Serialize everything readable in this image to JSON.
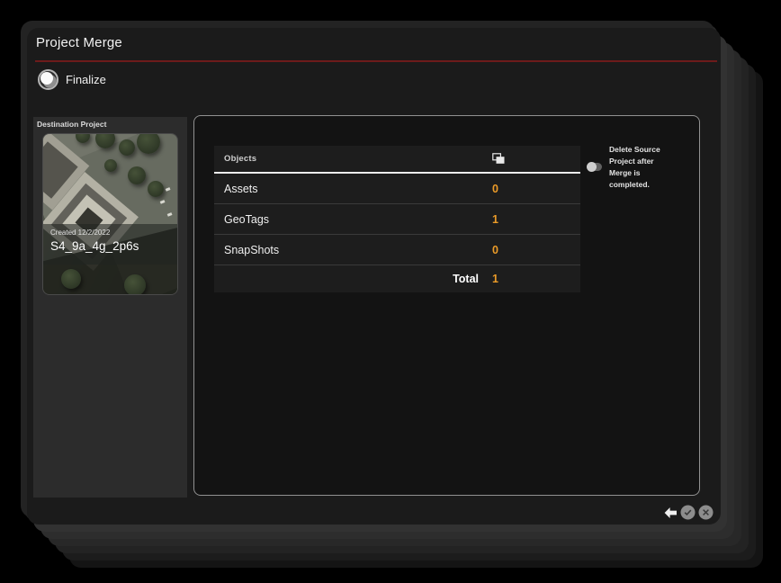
{
  "window": {
    "title": "Project Merge"
  },
  "step": {
    "label": "Finalize"
  },
  "sidebar": {
    "title": "Destination Project",
    "project": {
      "created": "Created 12/2/2022",
      "name": "S4_9a_4g_2p6s"
    }
  },
  "table": {
    "header": "Objects",
    "rows": [
      {
        "label": "Assets",
        "value": "0"
      },
      {
        "label": "GeoTags",
        "value": "1"
      },
      {
        "label": "SnapShots",
        "value": "0"
      }
    ],
    "total_label": "Total",
    "total_value": "1"
  },
  "toggle": {
    "label": "Delete Source Project after Merge is completed.",
    "state": "off"
  },
  "icons": {
    "step": "merge-spheres-icon",
    "table_header": "copy-icon",
    "toggle": "switch-off",
    "footer": [
      "back-arrow-icon",
      "check-circle-icon",
      "close-circle-icon"
    ]
  },
  "colors": {
    "value_accent": "#EB9B28",
    "title_divider": "#6D1B1B",
    "window_bg": "#1B1B1B",
    "sidebar_bg": "#2C2C2C",
    "panel_bg": "#131313",
    "table_bg": "#1D1D1D"
  }
}
